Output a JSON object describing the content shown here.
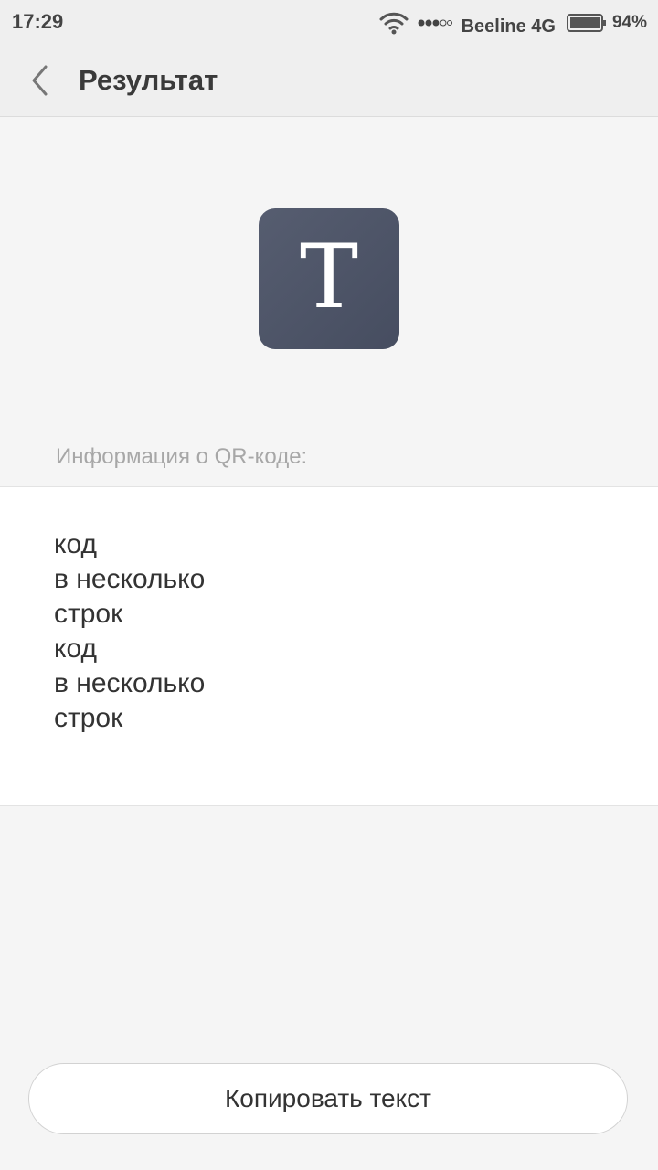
{
  "status_bar": {
    "time": "17:29",
    "carrier": "Beeline 4G",
    "battery_level": "94%",
    "icons": [
      "wifi-icon",
      "signal-icon",
      "battery-icon"
    ]
  },
  "header": {
    "back_icon": "chevron-left-icon",
    "title": "Результат"
  },
  "result": {
    "type_icon": "text-type-icon",
    "type_letter": "T",
    "section_label": "Информация о QR-коде:",
    "content": "код\nв несколько\nстрок\nкод\nв несколько\nстрок"
  },
  "actions": {
    "copy_label": "Копировать текст"
  },
  "colors": {
    "background": "#f5f5f5",
    "header_background": "#efefef",
    "icon_tile": "#4e5568",
    "panel": "#ffffff"
  }
}
